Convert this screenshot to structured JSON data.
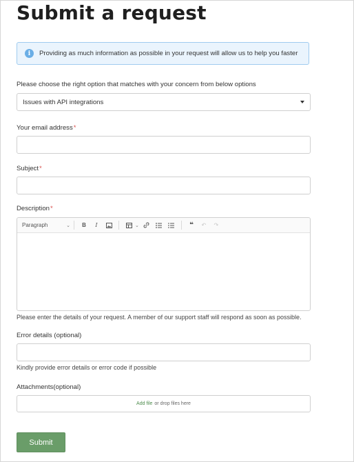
{
  "page": {
    "title": "Submit a request"
  },
  "info_banner": {
    "icon": "info-icon",
    "text": "Providing as much information as possible in your request will allow us to help you faster"
  },
  "concern": {
    "label": "Please choose the right option that matches with your concern from below options",
    "selected": "Issues with API integrations"
  },
  "email": {
    "label": "Your email address",
    "required_mark": "*",
    "value": ""
  },
  "subject": {
    "label": "Subject",
    "required_mark": "*",
    "value": ""
  },
  "description": {
    "label": "Description",
    "required_mark": "*",
    "toolbar": {
      "heading_select": "Paragraph",
      "buttons": [
        "bold-icon",
        "italic-icon",
        "image-icon",
        "table-icon",
        "link-icon",
        "bulleted-list-icon",
        "numbered-list-icon",
        "blockquote-icon",
        "undo-icon",
        "redo-icon"
      ]
    },
    "help": "Please enter the details of your request. A member of our support staff will respond as soon as possible."
  },
  "error_details": {
    "label": "Error details",
    "label_suffix": " (optional)",
    "value": "",
    "help": "Kindly provide error details or error code if possible"
  },
  "attachments": {
    "label": "Attachments",
    "label_suffix": "(optional)",
    "add_link": "Add file",
    "drop_text": "or drop files here"
  },
  "submit": {
    "label": "Submit"
  },
  "colors": {
    "accent_green": "#6a9d69",
    "required_red": "#d9534f",
    "info_bg": "#eaf4fd"
  }
}
